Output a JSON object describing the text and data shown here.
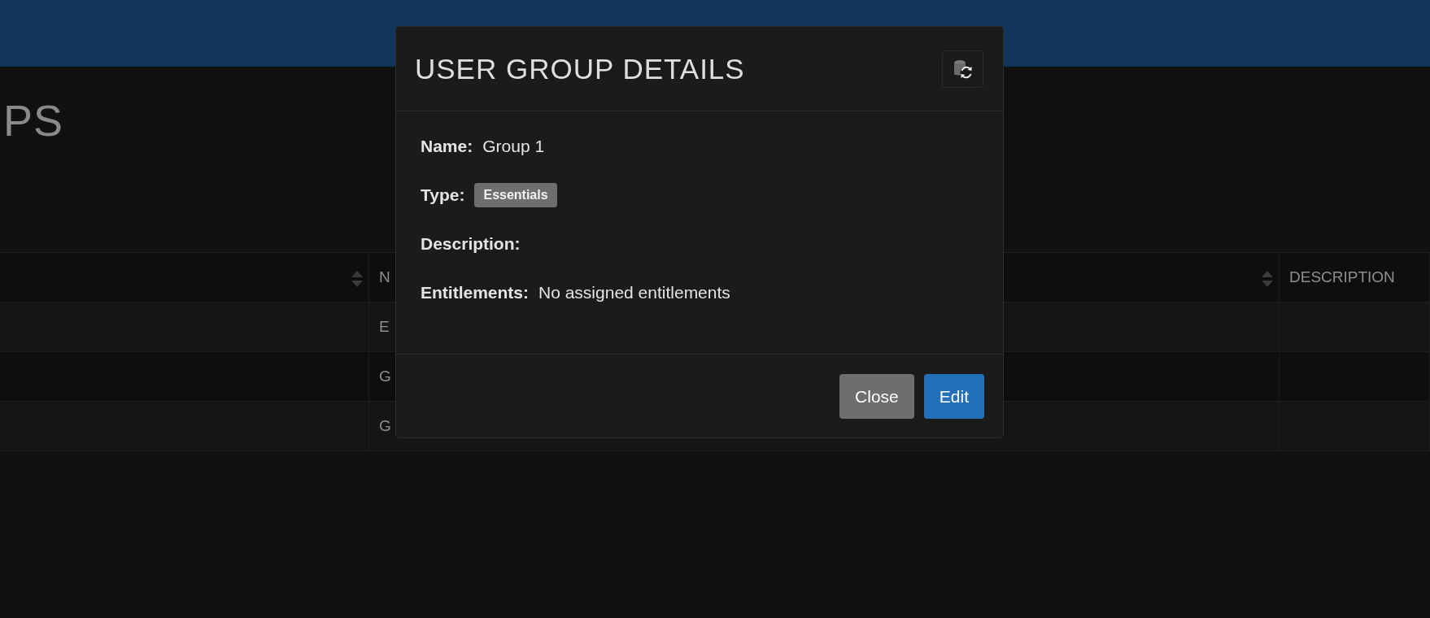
{
  "page_title": "PS",
  "table": {
    "columns": [
      {
        "sortable": true
      },
      {
        "label": "N",
        "sortable": true
      },
      {
        "label": "DESCRIPTION",
        "sortable": false
      }
    ],
    "rows": [
      {
        "cell_2": "E"
      },
      {
        "cell_2": "G"
      },
      {
        "cell_2": "G"
      }
    ]
  },
  "modal": {
    "title": "USER GROUP DETAILS",
    "fields": [
      {
        "label": "Name:",
        "kind": "text",
        "value": "Group 1"
      },
      {
        "label": "Type:",
        "kind": "badge",
        "value": "Essentials"
      },
      {
        "label": "Description:",
        "kind": "text"
      },
      {
        "label": "Entitlements:",
        "kind": "text",
        "value": "No assigned entitlements"
      }
    ],
    "buttons": [
      {
        "label": "Close",
        "kind": "secondary"
      },
      {
        "label": "Edit",
        "kind": "primary"
      }
    ]
  }
}
